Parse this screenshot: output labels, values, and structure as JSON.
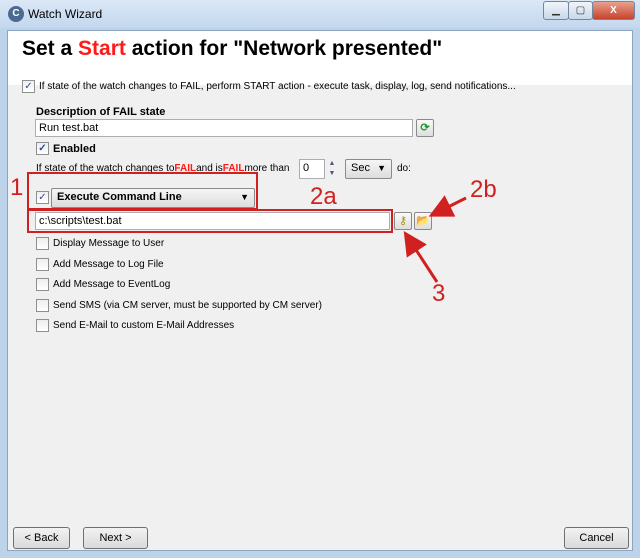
{
  "window": {
    "title": "Watch Wizard",
    "minimize": "▁",
    "maximize": "▢",
    "close": "X"
  },
  "header": {
    "prefix": "Set a ",
    "highlight": "Start",
    "suffix": " action for \"Network presented\""
  },
  "main_checkbox": {
    "checked": true,
    "label": "If state of the watch changes to FAIL, perform START action - execute task, display, log, send notifications..."
  },
  "description": {
    "label": "Description of FAIL state",
    "value": "Run test.bat"
  },
  "enabled": {
    "checked": true,
    "label": "Enabled"
  },
  "condition": {
    "part1": "If state of the watch changes to ",
    "fail1": "FAIL",
    "part2": " and is ",
    "fail2": "FAIL",
    "part3": " more than",
    "value": "0",
    "unit": "Sec",
    "suffix": "do:"
  },
  "action": {
    "checked": true,
    "selected": "Execute Command Line",
    "command": "c:\\scripts\\test.bat"
  },
  "options": [
    {
      "label": "Display Message to User",
      "checked": false
    },
    {
      "label": "Add Message to Log File",
      "checked": false
    },
    {
      "label": "Add Message to EventLog",
      "checked": false
    },
    {
      "label": "Send SMS (via CM server, must be supported by CM server)",
      "checked": false
    },
    {
      "label": "Send E-Mail to custom E-Mail Addresses",
      "checked": false
    }
  ],
  "buttons": {
    "back": "< Back",
    "next": "Next >",
    "cancel": "Cancel"
  },
  "annotations": {
    "a1": "1",
    "a2a": "2a",
    "a2b": "2b",
    "a3": "3",
    "color": "#d02020"
  }
}
